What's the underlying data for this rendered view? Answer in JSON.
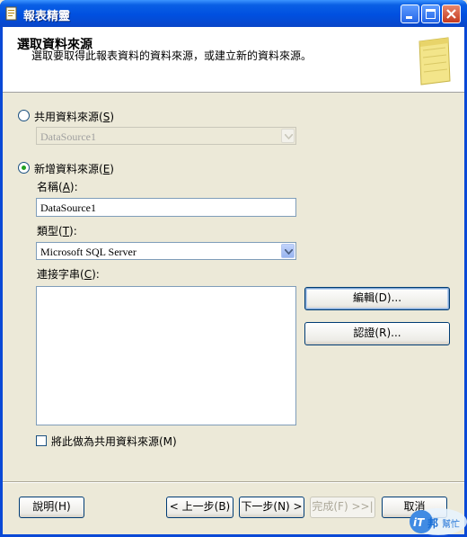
{
  "window": {
    "title": "報表精靈",
    "colors": {
      "titlebar": "#0a5fe5",
      "client": "#ece9d8",
      "accent_radio": "#21a121"
    }
  },
  "header": {
    "title": "選取資料來源",
    "subtitle": "選取要取得此報表資料的資料來源，或建立新的資料來源。",
    "art_icon": "notepad-icon"
  },
  "shared_source": {
    "label_pre": "共用資料來源(",
    "label_key": "S",
    "label_post": ")",
    "selected": false,
    "dropdown_value": "DataSource1"
  },
  "new_source": {
    "label_pre": "新增資料來源(",
    "label_key": "E",
    "label_post": ")",
    "selected": true,
    "name_label_pre": "名稱(",
    "name_label_key": "A",
    "name_label_post": "):",
    "name_value": "DataSource1",
    "type_label_pre": "類型(",
    "type_label_key": "T",
    "type_label_post": "):",
    "type_value": "Microsoft SQL Server",
    "conn_label_pre": "連接字串(",
    "conn_label_key": "C",
    "conn_label_post": "):",
    "conn_value": "",
    "edit_button": "編輯(D)...",
    "credentials_button": "認證(R)...",
    "make_shared_label": "將此做為共用資料來源(M)",
    "make_shared_checked": false
  },
  "footer": {
    "help_button": "說明(H)",
    "back_button": "< 上一步(B)",
    "next_button": "下一步(N) >",
    "finish_button": "完成(F) >>|",
    "cancel_button": "取消"
  },
  "watermark": {
    "text_a": "iT邦",
    "text_b": "幫忙"
  }
}
